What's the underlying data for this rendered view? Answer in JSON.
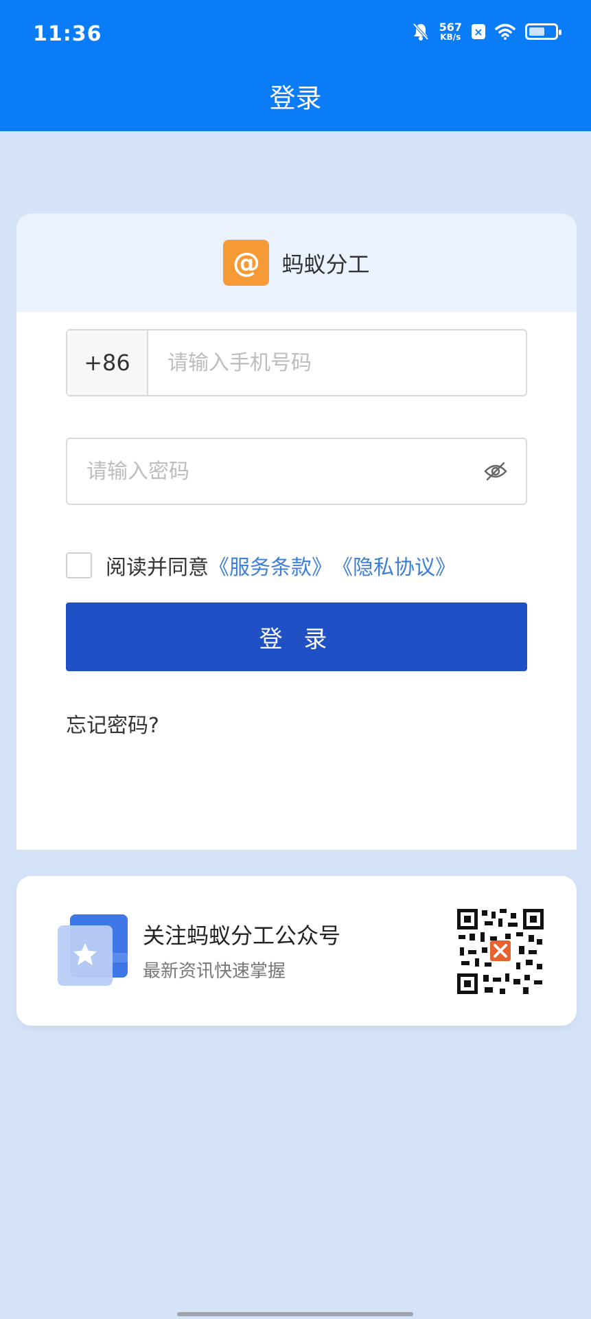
{
  "status_bar": {
    "time": "11:36",
    "net_speed_value": "567",
    "net_speed_unit": "KB/s",
    "sim_badge": "×",
    "battery_level_percent": 60,
    "icons": [
      "bell-off-icon",
      "sim-icon",
      "wifi-icon",
      "battery-icon"
    ]
  },
  "header": {
    "title": "登录"
  },
  "card": {
    "app_name": "蚂蚁分工",
    "logo_glyph": "@",
    "phone": {
      "prefix": "+86",
      "value": "",
      "placeholder": "请输入手机号码"
    },
    "password": {
      "value": "",
      "placeholder": "请输入密码",
      "toggle_icon": "eye-off-icon"
    },
    "agreement": {
      "text": "阅读并同意",
      "terms_label": "《服务条款》",
      "privacy_label": "《隐私协议》",
      "checked": false
    },
    "login_button_label": "登 录",
    "forgot_label": "忘记密码?"
  },
  "follow": {
    "title": "关注蚂蚁分工公众号",
    "subtitle": "最新资讯快速掌握",
    "icon": "star-card-icon",
    "qr_icon": "qr-code-icon"
  },
  "colors": {
    "header": "#0a7cf8",
    "background": "#d5e3f9",
    "primary_button": "#1f50c5",
    "link": "#3d7fd7",
    "logo": "#f59a35"
  }
}
